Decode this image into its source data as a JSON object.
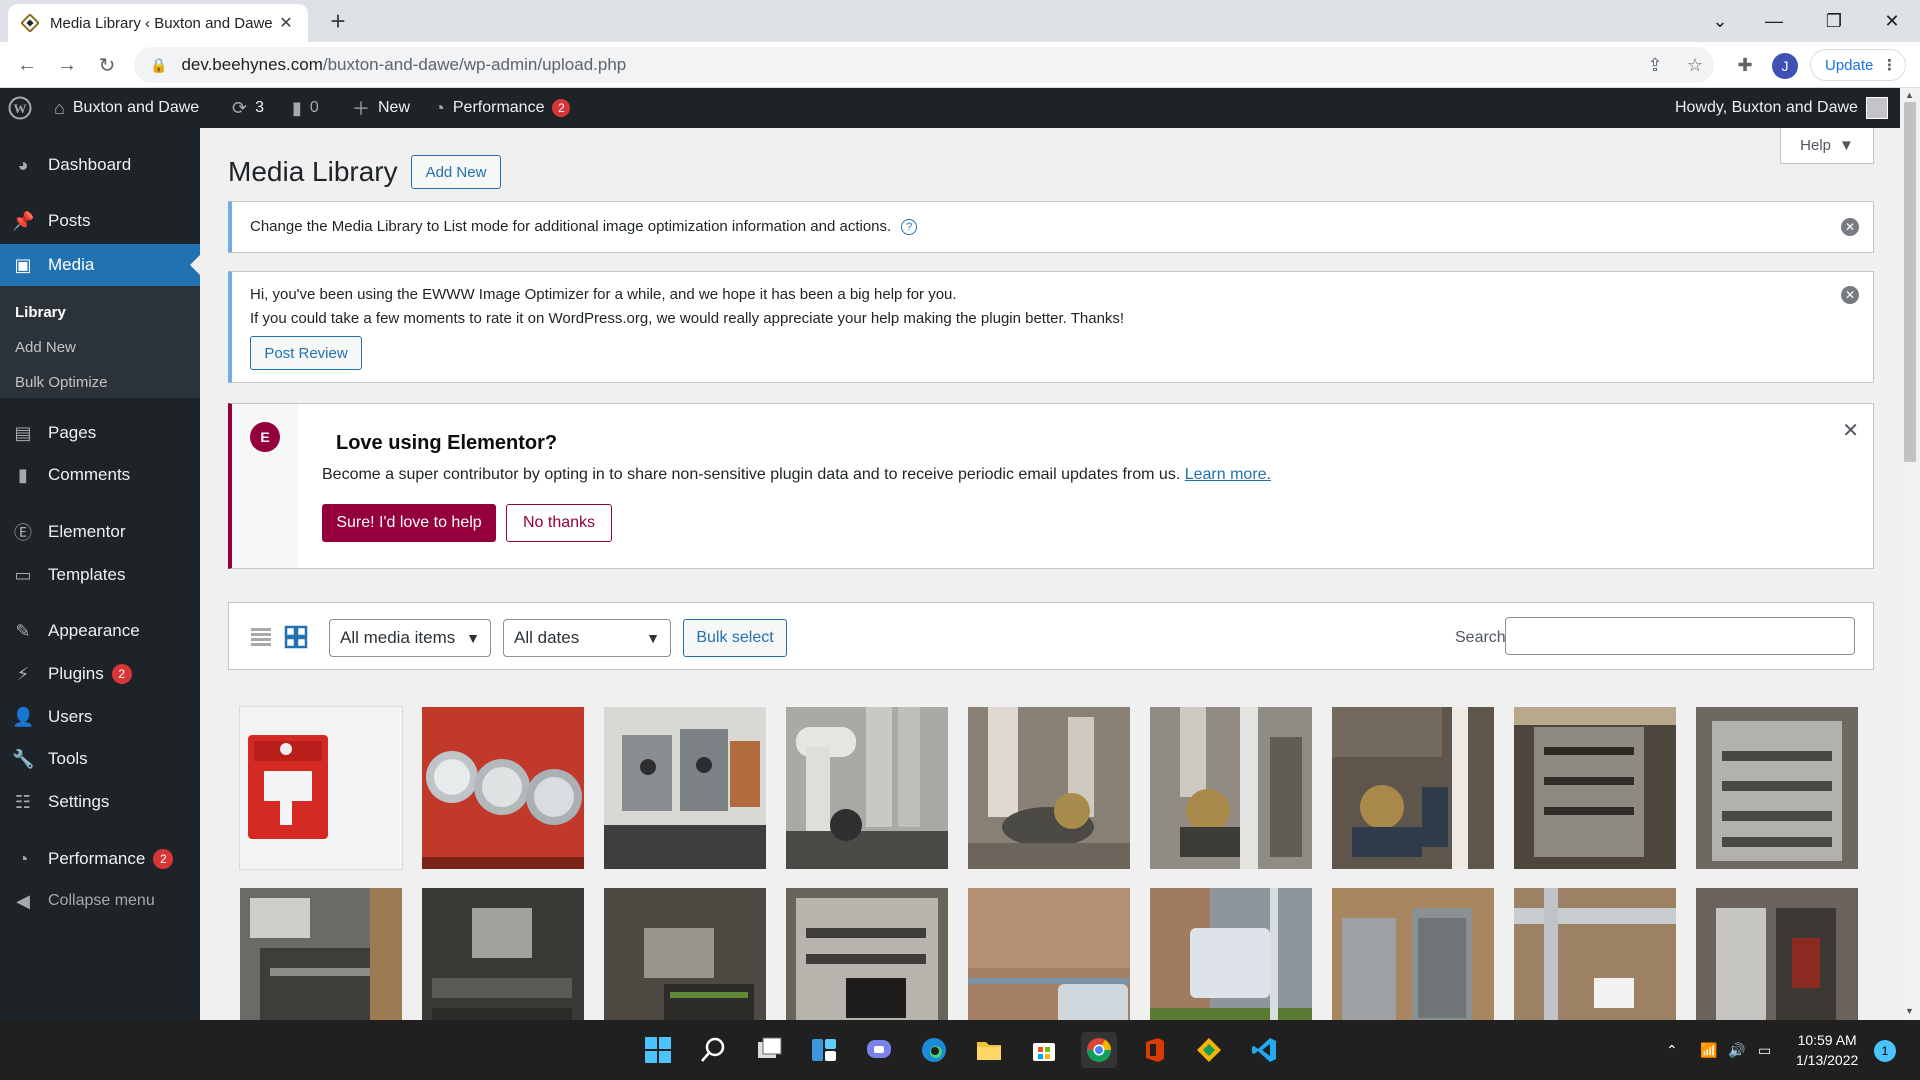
{
  "browser": {
    "tab_title": "Media Library ‹ Buxton and Dawe",
    "url_host": "dev.beehynes.com",
    "url_path": "/buxton-and-dawe/wp-admin/upload.php",
    "profile_initial": "J",
    "update_label": "Update"
  },
  "adminbar": {
    "site_name": "Buxton and Dawe",
    "updates_count": "3",
    "comments_count": "0",
    "new_label": "New",
    "performance_label": "Performance",
    "performance_badge": "2",
    "howdy": "Howdy, Buxton and Dawe"
  },
  "sidebar": {
    "items": [
      {
        "label": "Dashboard",
        "icon": "dashboard-icon"
      },
      {
        "label": "Posts",
        "icon": "pin-icon"
      },
      {
        "label": "Media",
        "icon": "media-icon"
      },
      {
        "label": "Pages",
        "icon": "page-icon"
      },
      {
        "label": "Comments",
        "icon": "comment-icon"
      },
      {
        "label": "Elementor",
        "icon": "elementor-icon"
      },
      {
        "label": "Templates",
        "icon": "folder-icon"
      },
      {
        "label": "Appearance",
        "icon": "brush-icon"
      },
      {
        "label": "Plugins",
        "icon": "plug-icon",
        "badge": "2"
      },
      {
        "label": "Users",
        "icon": "user-icon"
      },
      {
        "label": "Tools",
        "icon": "wrench-icon"
      },
      {
        "label": "Settings",
        "icon": "sliders-icon"
      },
      {
        "label": "Performance",
        "icon": "gauge-icon",
        "badge": "2"
      },
      {
        "label": "Collapse menu",
        "icon": "collapse-icon"
      }
    ],
    "submenu": [
      "Library",
      "Add New",
      "Bulk Optimize"
    ]
  },
  "main": {
    "title": "Media Library",
    "add_new": "Add New",
    "help": "Help",
    "notice1": "Change the Media Library to List mode for additional image optimization information and actions.",
    "notice2_line1": "Hi, you've been using the EWWW Image Optimizer for a while, and we hope it has been a big help for you.",
    "notice2_line2": "If you could take a few moments to rate it on WordPress.org, we would really appreciate your help making the plugin better. Thanks!",
    "post_review": "Post Review",
    "elementor": {
      "title": "Love using Elementor?",
      "text": "Become a super contributor by opting in to share non-sensitive plugin data and to receive periodic email updates from us.",
      "learn_more": "Learn more.",
      "primary": "Sure! I'd love to help",
      "secondary": "No thanks"
    },
    "filters": {
      "type": "All media items",
      "dates": "All dates",
      "bulk_select": "Bulk select",
      "search_label": "Search"
    }
  },
  "taskbar": {
    "time": "10:59 AM",
    "date": "1/13/2022",
    "notifications": "1"
  }
}
